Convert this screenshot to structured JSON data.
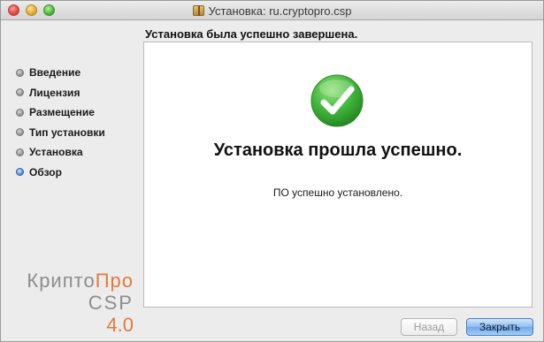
{
  "window": {
    "title": "Установка: ru.cryptopro.csp"
  },
  "header": {
    "heading": "Установка была успешно завершена."
  },
  "sidebar": {
    "steps": [
      {
        "label": "Введение",
        "active": false
      },
      {
        "label": "Лицензия",
        "active": false
      },
      {
        "label": "Размещение",
        "active": false
      },
      {
        "label": "Тип установки",
        "active": false
      },
      {
        "label": "Установка",
        "active": false
      },
      {
        "label": "Обзор",
        "active": true
      }
    ],
    "logo": {
      "part1": "Крипто",
      "part2": "Про",
      "line2": "CSP",
      "line3": "4.0"
    }
  },
  "main": {
    "success_title": "Установка прошла успешно.",
    "success_message": "ПО успешно установлено.",
    "icon": "checkmark-success-icon"
  },
  "buttons": {
    "back_label": "Назад",
    "close_label": "Закрыть"
  },
  "colors": {
    "check_green": "#3fb53b",
    "logo_orange": "#e07b3c",
    "default_button_blue": "#6ea7ea"
  }
}
